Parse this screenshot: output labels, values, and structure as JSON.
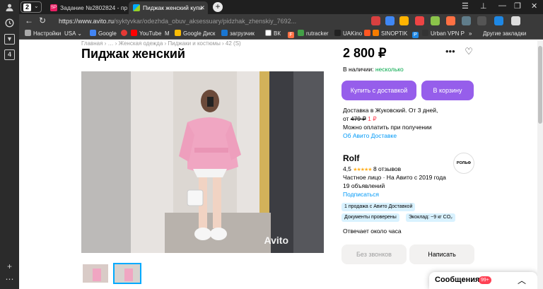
{
  "browser": {
    "tab_count": "2",
    "tabs": [
      {
        "title": "Задание №2802824 - про",
        "color": "#e91e63"
      },
      {
        "title": "Пиджак женский купи",
        "color": "#00aaff"
      }
    ],
    "url_host": "https://www.avito.ru",
    "url_path": "/syktyvkar/odezhda_obuv_aksessuary/pidzhak_zhenskiy_7692...",
    "bookmarks": [
      "Настройки",
      "USA",
      "Google",
      "YouTube",
      "M",
      "Google Диск",
      "загрузчик",
      "ВК",
      "F",
      "rutracker",
      "UAKino",
      "",
      "SINOPTIK",
      "P",
      "Urban VPN P"
    ],
    "other_bookmarks": "Другие закладки"
  },
  "listing": {
    "breadcrumbs": "Главная › … › Женская одежда › Пиджаки и костюмы › 42 (S)",
    "title": "Пиджак женский",
    "price": "2 800 ₽",
    "availability_label": "В наличии:",
    "availability_value": "несколько",
    "buy_delivery_label": "Купить с доставкой",
    "cart_label": "В корзину",
    "delivery_line": "Доставка в Жуковский. От 3 дней,",
    "delivery_from": "от",
    "delivery_old_price": "479 ₽",
    "delivery_new_price": "1 ₽",
    "pay_on_receipt": "Можно оплатить при получении",
    "about_delivery_link": "Об Авито Доставке",
    "watermark": "Avito"
  },
  "seller": {
    "name": "Rolf",
    "rating": "4,5",
    "stars": "★★★★★",
    "reviews": "8 отзывов",
    "since": "Частное лицо · На Авито с 2019 года",
    "ads_count": "19 объявлений",
    "subscribe_link": "Подписаться",
    "logo_text": "РОЛЬФ",
    "chips": [
      "1 продажа с Авито Доставкой",
      "Документы проверены",
      "Экоклад: ~9 кг CO₂"
    ],
    "response_time": "Отвечает около часа",
    "no_calls_label": "Без звонков",
    "write_label": "Написать"
  },
  "messages": {
    "label": "Сообщения",
    "badge": "99+"
  }
}
